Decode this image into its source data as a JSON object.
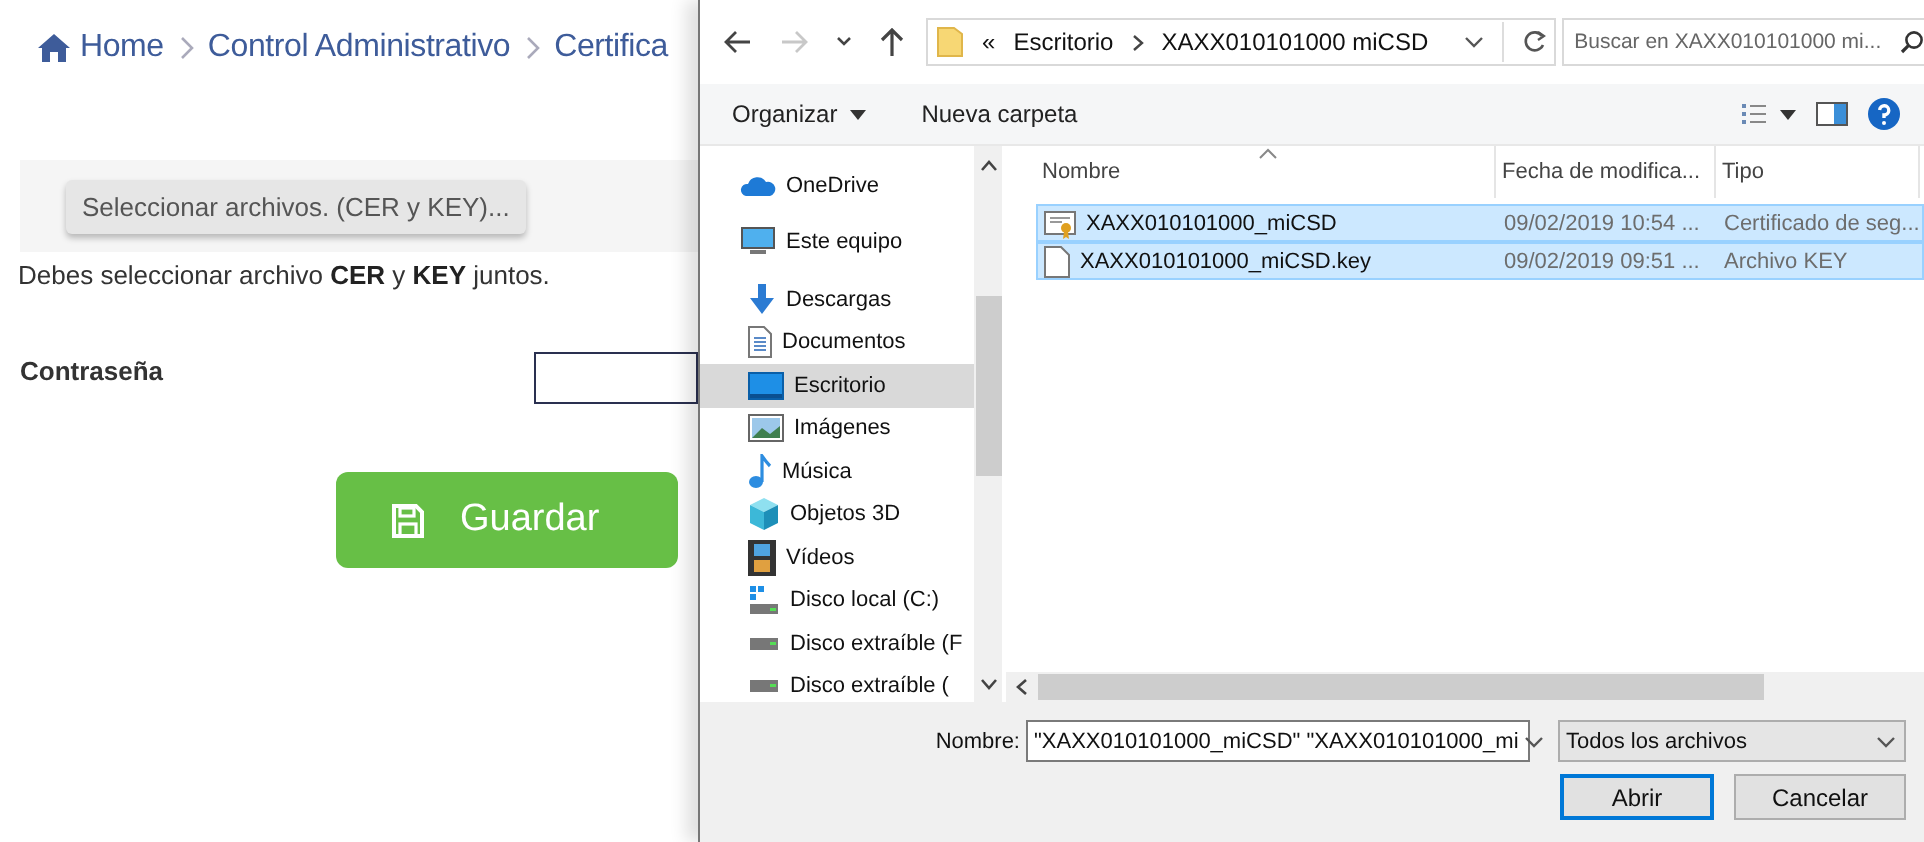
{
  "page": {
    "breadcrumb": [
      {
        "kind": "home",
        "label": "Home"
      },
      {
        "kind": "link",
        "label": "Control Administrativo"
      },
      {
        "kind": "link",
        "label": "Certifica"
      }
    ],
    "file_button": "Seleccionar archivos. (CER y KEY)...",
    "hint": "Debes seleccionar archivo **CER** y **KEY** juntos.",
    "password_label": "Contraseña",
    "save_button": "Guardar"
  },
  "dialog": {
    "nav_buttons": [
      {
        "kind": "back",
        "disabled": false
      },
      {
        "kind": "forward",
        "disabled": true
      },
      {
        "kind": "recent",
        "disabled": false
      },
      {
        "kind": "up",
        "disabled": false
      }
    ],
    "address": {
      "overflow_mark": "«",
      "segments": [
        "Escritorio",
        "XAXX010101000 miCSD"
      ]
    },
    "search": {
      "placeholder": "Buscar en XAXX010101000 mi..."
    },
    "commands": [
      {
        "kind": "menu",
        "label": "Organizar"
      },
      {
        "kind": "plain",
        "label": "Nueva carpeta"
      }
    ],
    "sidebar": [
      {
        "kind": "cloud",
        "label": "OneDrive",
        "selected": false
      },
      {
        "kind": "computer",
        "label": "Este equipo",
        "selected": false,
        "children": [
          {
            "kind": "downloads",
            "label": "Descargas",
            "selected": false
          },
          {
            "kind": "documents",
            "label": "Documentos",
            "selected": false
          },
          {
            "kind": "desktop",
            "label": "Escritorio",
            "selected": true
          },
          {
            "kind": "pictures",
            "label": "Imágenes",
            "selected": false
          },
          {
            "kind": "music",
            "label": "Música",
            "selected": false
          },
          {
            "kind": "objects",
            "label": "Objetos 3D",
            "selected": false
          },
          {
            "kind": "videos",
            "label": "Vídeos",
            "selected": false
          },
          {
            "kind": "localdisk",
            "label": "Disco local (C:)",
            "selected": false
          },
          {
            "kind": "drive",
            "label": "Disco extraíble (F",
            "selected": false
          },
          {
            "kind": "drive",
            "label": "Disco extraíble (",
            "selected": false
          }
        ]
      }
    ],
    "columns": [
      "Nombre",
      "Fecha de modifica...",
      "Tipo"
    ],
    "files": [
      {
        "kind": "certificate",
        "name": "XAXX010101000_miCSD",
        "date": "09/02/2019 10:54 ...",
        "type": "Certificado de seg...",
        "selected": true
      },
      {
        "kind": "file",
        "name": "XAXX010101000_miCSD.key",
        "date": "09/02/2019 09:51 ...",
        "type": "Archivo KEY",
        "selected": true
      }
    ],
    "filename_label": "Nombre:",
    "filename": "\"XAXX010101000_miCSD\" \"XAXX010101000_mi",
    "filter": "Todos los archivos",
    "buttons": [
      {
        "kind": "primary",
        "label": "Abrir"
      },
      {
        "kind": "normal",
        "label": "Cancelar"
      }
    ]
  }
}
